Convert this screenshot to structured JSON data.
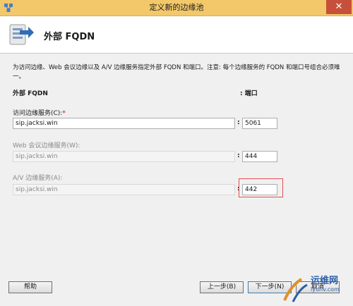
{
  "window": {
    "title": "定义新的边缘池"
  },
  "header": {
    "title": "外部 FQDN"
  },
  "description": "为访问边缘、Web 会议边缘以及 A/V 边缘服务指定外部 FQDN 和端口。注意: 每个边缘服务的 FQDN 和端口号组合必须唯一。",
  "columns": {
    "fqdn": "外部 FQDN",
    "port": "端口"
  },
  "services": [
    {
      "label": "访问边缘服务(C):",
      "required_mark": "*",
      "fqdn": "sip.jacksi.win",
      "port": "5061",
      "enabled": true
    },
    {
      "label": "Web 会议边缘服务(W):",
      "required_mark": "",
      "fqdn": "sip.jacksi.win",
      "port": "444",
      "enabled": false
    },
    {
      "label": "A/V 边缘服务(A):",
      "required_mark": "",
      "fqdn": "sip.jacksi.win",
      "port": "442",
      "enabled": false
    }
  ],
  "separator": ":",
  "buttons": {
    "help": "帮助",
    "back": "上一步(B)",
    "next": "下一步(N)",
    "cancel": "取消"
  },
  "watermark": {
    "text": "运维网",
    "url": "iyunv.com"
  },
  "colors": {
    "titlebar": "#f3c86a",
    "close": "#c7503a",
    "highlight": "#e05050",
    "watermark": "#2b5fa6"
  },
  "icons": {
    "app": "app-icon",
    "header": "server-arrow-icon",
    "close": "close-icon"
  }
}
